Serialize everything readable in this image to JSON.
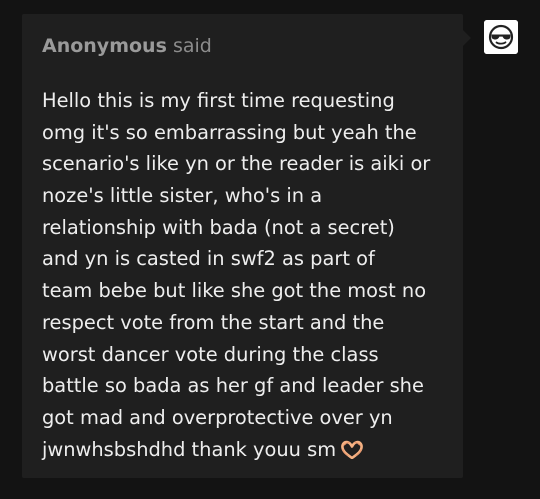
{
  "ask": {
    "asker_name": "Anonymous",
    "asker_verb": "said",
    "question_lines": [
      "Hello this is my first time requesting",
      "omg it's so embarrassing but yeah the",
      "scenario's like yn or the reader is aiki or",
      "noze's little sister, who's in a",
      "relationship with bada (not a secret)",
      "and yn is casted in swf2 as part of",
      "team bebe but like she got the most no",
      "respect vote from the start and the",
      "worst dancer vote during the class",
      "battle so bada as her gf and leader she",
      "got mad and overprotective over yn",
      "jwnwhsbshdhd thank youu sm"
    ],
    "emoji_icon": "heart-hands-icon"
  },
  "avatar": {
    "icon": "sunglasses-face-icon"
  },
  "colors": {
    "background": "#131313",
    "card": "#1f1f1f",
    "asker_text": "#9a9a9a",
    "body_text": "#eeeeee",
    "emoji": "#f4b183"
  }
}
